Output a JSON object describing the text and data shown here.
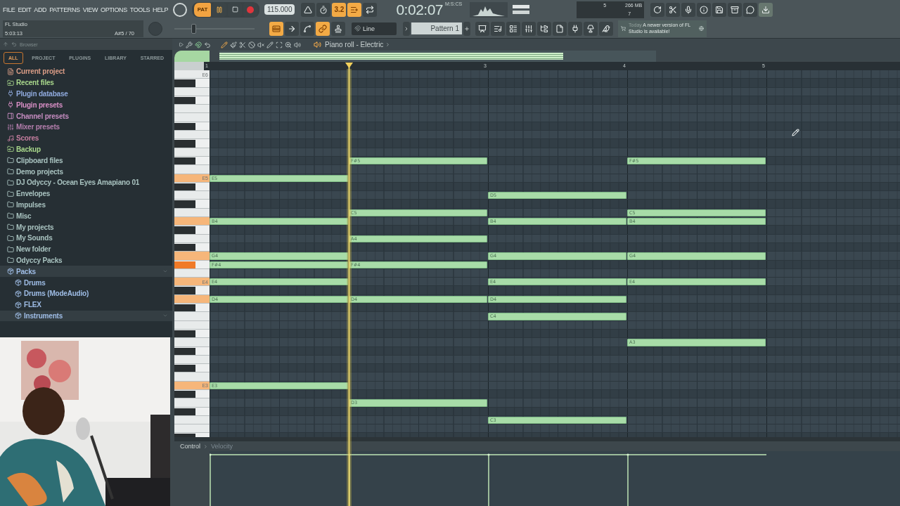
{
  "menu": [
    "FILE",
    "EDIT",
    "ADD",
    "PATTERNS",
    "VIEW",
    "OPTIONS",
    "TOOLS",
    "HELP"
  ],
  "hint": {
    "title": "FL Studio",
    "time": "5:03:13",
    "note": "A#5 / 70"
  },
  "transport": {
    "mode": {
      "label": "PAT",
      "selected": true
    },
    "playing": true
  },
  "tempo": "115.000",
  "record_toggles": [
    {
      "kind": "metronome",
      "on": false
    },
    {
      "kind": "wait",
      "on": false
    },
    {
      "kind": "countdown",
      "label": "3.2",
      "on": true
    },
    {
      "kind": "overdub",
      "on": true
    },
    {
      "kind": "loop",
      "on": false
    }
  ],
  "time": {
    "value": "0:02:07",
    "unit": "M:S:CS"
  },
  "meters": {
    "cpu": "5",
    "memory": "266 MB",
    "polyphony": "7"
  },
  "master_slider": {
    "level": 0.24
  },
  "edit_toggles": [
    {
      "kind": "step",
      "on": true
    },
    {
      "kind": "arrow",
      "on": false
    },
    {
      "kind": "slide",
      "on": false
    },
    {
      "kind": "link",
      "on": true
    },
    {
      "kind": "stamp",
      "on": false
    }
  ],
  "tool_mode": "Line",
  "pattern": "Pattern 1",
  "news": {
    "day": "Today",
    "message": "A newer version of FL Studio is available!"
  },
  "browser": {
    "title": "Browser",
    "tabs": [
      {
        "label": "ALL",
        "selected": true
      },
      {
        "label": "PROJECT",
        "selected": false
      },
      {
        "label": "PLUGINS",
        "selected": false
      },
      {
        "label": "LIBRARY",
        "selected": false
      },
      {
        "label": "STARRED",
        "selected": false
      }
    ],
    "items": [
      {
        "kind": "file",
        "label": "Current project",
        "color": "#d99c86"
      },
      {
        "kind": "linked-folder",
        "label": "Recent files",
        "color": "#a9d88c"
      },
      {
        "kind": "plug",
        "label": "Plugin database",
        "color": "#8fa9dc"
      },
      {
        "kind": "plug",
        "label": "Plugin presets",
        "color": "#d98fc6"
      },
      {
        "kind": "channel",
        "label": "Channel presets",
        "color": "#c58cc0"
      },
      {
        "kind": "mixer",
        "label": "Mixer presets",
        "color": "#b57fae"
      },
      {
        "kind": "note",
        "label": "Scores",
        "color": "#c67ea0"
      },
      {
        "kind": "linked-folder",
        "label": "Backup",
        "color": "#a9d88c"
      },
      {
        "kind": "folder",
        "label": "Clipboard files",
        "color": "#a9c3c0"
      },
      {
        "kind": "folder",
        "label": "Demo projects",
        "color": "#a9c3c0"
      },
      {
        "kind": "folder",
        "label": "DJ Odyccy - Ocean Eyes Amapiano 01",
        "color": "#a9c3c0"
      },
      {
        "kind": "folder",
        "label": "Envelopes",
        "color": "#a9c3c0"
      },
      {
        "kind": "folder",
        "label": "Impulses",
        "color": "#a9c3c0"
      },
      {
        "kind": "folder",
        "label": "Misc",
        "color": "#a9c3c0"
      },
      {
        "kind": "folder",
        "label": "My projects",
        "color": "#a9c3c0"
      },
      {
        "kind": "folder",
        "label": "My Sounds",
        "color": "#a9c3c0"
      },
      {
        "kind": "folder",
        "label": "New folder",
        "color": "#a9c3c0"
      },
      {
        "kind": "folder",
        "label": "Odyccy Packs",
        "color": "#a9c3c0"
      },
      {
        "kind": "pack",
        "label": "Packs",
        "color": "#9fbde6",
        "expanded": true,
        "children": [
          {
            "kind": "pack",
            "label": "Drums",
            "color": "#9fbde6",
            "expanded": false
          },
          {
            "kind": "pack",
            "label": "Drums (ModeAudio)",
            "color": "#9fbde6",
            "expanded": false
          },
          {
            "kind": "pack",
            "label": "FLEX",
            "color": "#9fbde6",
            "expanded": false
          },
          {
            "kind": "pack",
            "label": "Instruments",
            "color": "#9fbde6",
            "expanded": true
          }
        ]
      }
    ]
  },
  "piano_roll": {
    "title": "Piano roll - Electric",
    "bars": [
      {
        "number": "1",
        "playhead": false
      },
      {
        "playhead": true
      },
      {
        "number": "3",
        "playhead": false
      },
      {
        "number": "4",
        "playhead": false
      },
      {
        "number": "5",
        "playhead": false
      }
    ],
    "keys": [
      {
        "kind": "white",
        "label": "E6",
        "pressed": false
      },
      {
        "kind": "black",
        "pressed": false
      },
      {
        "kind": "white",
        "pressed": false
      },
      {
        "kind": "black",
        "pressed": false
      },
      {
        "kind": "white",
        "pressed": false
      },
      {
        "kind": "white",
        "pressed": false
      },
      {
        "kind": "black",
        "pressed": false
      },
      {
        "kind": "white",
        "pressed": false
      },
      {
        "kind": "black",
        "pressed": false
      },
      {
        "kind": "white",
        "pressed": false
      },
      {
        "kind": "black",
        "pressed": false,
        "cells": [
          {
            "on": false
          },
          {
            "on": true,
            "label": "F#5"
          },
          {
            "on": false
          },
          {
            "on": true,
            "label": "F#5"
          }
        ]
      },
      {
        "kind": "white",
        "pressed": false
      },
      {
        "kind": "white",
        "label": "E5",
        "pressed": true,
        "cells": [
          {
            "on": true,
            "label": "E5"
          },
          {
            "on": false
          },
          {
            "on": false
          },
          {
            "on": false
          }
        ]
      },
      {
        "kind": "black",
        "pressed": false
      },
      {
        "kind": "white",
        "pressed": false,
        "cells": [
          {
            "on": false
          },
          {
            "on": false
          },
          {
            "on": true,
            "label": "D5"
          },
          {
            "on": false
          }
        ]
      },
      {
        "kind": "black",
        "pressed": false
      },
      {
        "kind": "white",
        "pressed": false,
        "cells": [
          {
            "on": false
          },
          {
            "on": true,
            "label": "C5"
          },
          {
            "on": false
          },
          {
            "on": true,
            "label": "C5"
          }
        ]
      },
      {
        "kind": "white",
        "pressed": true,
        "cells": [
          {
            "on": true,
            "label": "B4"
          },
          {
            "on": false
          },
          {
            "on": true,
            "label": "B4"
          },
          {
            "on": true,
            "label": "B4"
          }
        ]
      },
      {
        "kind": "black",
        "pressed": false
      },
      {
        "kind": "white",
        "pressed": false,
        "cells": [
          {
            "on": false
          },
          {
            "on": true,
            "label": "A4"
          },
          {
            "on": false
          },
          {
            "on": false
          }
        ]
      },
      {
        "kind": "black",
        "pressed": false
      },
      {
        "kind": "white",
        "pressed": true,
        "cells": [
          {
            "on": true,
            "label": "G4"
          },
          {
            "on": false
          },
          {
            "on": true,
            "label": "G4"
          },
          {
            "on": true,
            "label": "G4"
          }
        ]
      },
      {
        "kind": "black",
        "pressed": true,
        "cells": [
          {
            "on": true,
            "label": "F#4"
          },
          {
            "on": true,
            "label": "F#4"
          },
          {
            "on": false
          },
          {
            "on": false
          }
        ]
      },
      {
        "kind": "white",
        "pressed": false
      },
      {
        "kind": "white",
        "label": "E4",
        "pressed": true,
        "cells": [
          {
            "on": true,
            "label": "E4"
          },
          {
            "on": false
          },
          {
            "on": true,
            "label": "E4"
          },
          {
            "on": true,
            "label": "E4"
          }
        ]
      },
      {
        "kind": "black",
        "pressed": false
      },
      {
        "kind": "white",
        "pressed": true,
        "cells": [
          {
            "on": true,
            "label": "D4"
          },
          {
            "on": true,
            "label": "D4"
          },
          {
            "on": true,
            "label": "D4"
          },
          {
            "on": false
          }
        ]
      },
      {
        "kind": "black",
        "pressed": false
      },
      {
        "kind": "white",
        "pressed": false,
        "cells": [
          {
            "on": false
          },
          {
            "on": false
          },
          {
            "on": true,
            "label": "C4"
          },
          {
            "on": false
          }
        ]
      },
      {
        "kind": "white",
        "pressed": false
      },
      {
        "kind": "black",
        "pressed": false
      },
      {
        "kind": "white",
        "pressed": false,
        "cells": [
          {
            "on": false
          },
          {
            "on": false
          },
          {
            "on": false
          },
          {
            "on": true,
            "label": "A3"
          }
        ]
      },
      {
        "kind": "black",
        "pressed": false
      },
      {
        "kind": "white",
        "pressed": false
      },
      {
        "kind": "black",
        "pressed": false
      },
      {
        "kind": "white",
        "pressed": false
      },
      {
        "kind": "white",
        "label": "E3",
        "pressed": true,
        "cells": [
          {
            "on": true,
            "label": "E3"
          },
          {
            "on": false
          },
          {
            "on": false
          },
          {
            "on": false
          }
        ]
      },
      {
        "kind": "black",
        "pressed": false
      },
      {
        "kind": "white",
        "pressed": false,
        "cells": [
          {
            "on": false
          },
          {
            "on": true,
            "label": "D3"
          },
          {
            "on": false
          },
          {
            "on": false
          }
        ]
      },
      {
        "kind": "black",
        "pressed": false
      },
      {
        "kind": "white",
        "pressed": false,
        "cells": [
          {
            "on": false
          },
          {
            "on": false
          },
          {
            "on": true,
            "label": "C3"
          },
          {
            "on": false
          }
        ]
      },
      {
        "kind": "white",
        "pressed": false
      },
      {
        "kind": "black",
        "pressed": false
      }
    ],
    "control": {
      "label": "Control",
      "target": "Velocity"
    }
  }
}
